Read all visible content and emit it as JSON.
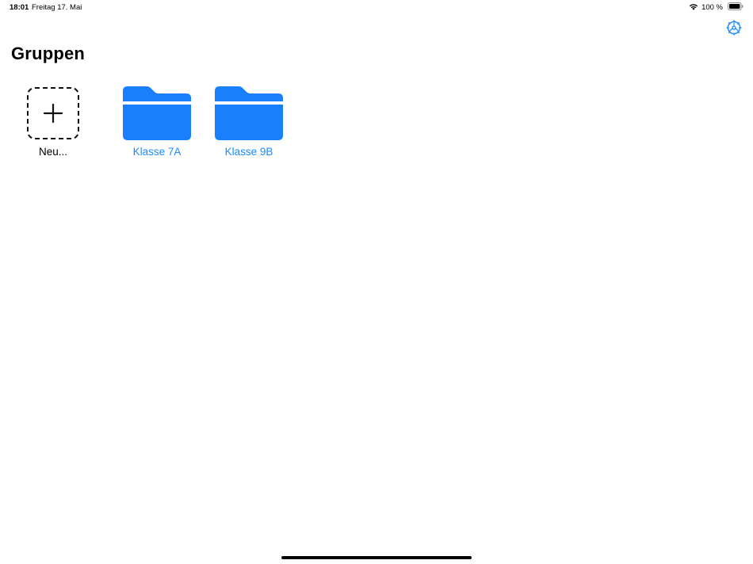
{
  "status_bar": {
    "time": "18:01",
    "date": "Freitag 17. Mai",
    "battery_percent": "100 %",
    "wifi_icon": "wifi-icon",
    "battery_icon": "battery-icon"
  },
  "header": {
    "title": "Gruppen",
    "settings_icon": "gear-icon"
  },
  "colors": {
    "accent": "#1a8cff",
    "folder": "#1a7ffb"
  },
  "groups": {
    "new_label": "Neu...",
    "items": [
      {
        "label": "Klasse 7A",
        "icon": "folder-icon"
      },
      {
        "label": "Klasse 9B",
        "icon": "folder-icon"
      }
    ]
  }
}
